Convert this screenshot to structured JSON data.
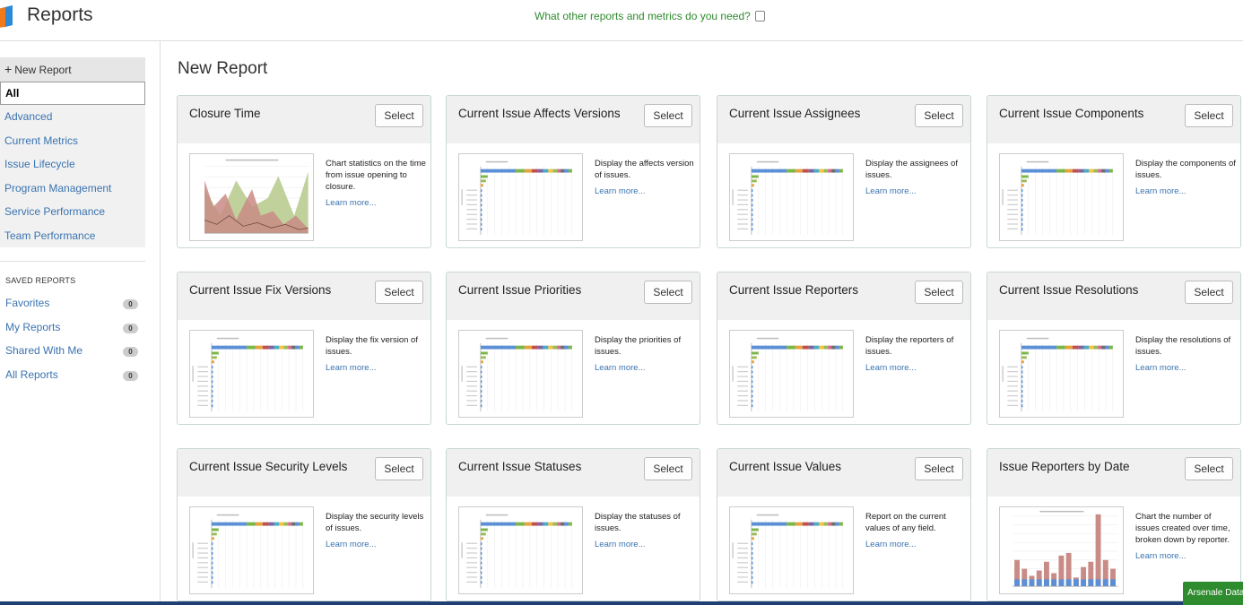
{
  "app": {
    "title": "Reports",
    "feedback_link": "What other reports and metrics do you need?"
  },
  "sidebar": {
    "new_report": "New Report",
    "categories": [
      "All",
      "Advanced",
      "Current Metrics",
      "Issue Lifecycle",
      "Program Management",
      "Service Performance",
      "Team Performance"
    ],
    "saved_heading": "SAVED REPORTS",
    "saved": [
      {
        "label": "Favorites",
        "count": "0"
      },
      {
        "label": "My Reports",
        "count": "0"
      },
      {
        "label": "Shared With Me",
        "count": "0"
      },
      {
        "label": "All Reports",
        "count": "0"
      }
    ]
  },
  "main": {
    "title": "New Report",
    "select_label": "Select",
    "learn_more": "Learn more...",
    "cards": [
      {
        "title": "Closure Time",
        "desc": "Chart statistics on the time from issue opening to closure.",
        "thumb": "area-chart"
      },
      {
        "title": "Current Issue Affects Versions",
        "desc": "Display the affects version of issues.",
        "thumb": "bar-chart"
      },
      {
        "title": "Current Issue Assignees",
        "desc": "Display the assignees of issues.",
        "thumb": "bar-chart"
      },
      {
        "title": "Current Issue Components",
        "desc": "Display the components of issues.",
        "thumb": "bar-chart"
      },
      {
        "title": "Current Issue Fix Versions",
        "desc": "Display the fix version of issues.",
        "thumb": "bar-chart"
      },
      {
        "title": "Current Issue Priorities",
        "desc": "Display the priorities of issues.",
        "thumb": "bar-chart"
      },
      {
        "title": "Current Issue Reporters",
        "desc": "Display the reporters of issues.",
        "thumb": "bar-chart"
      },
      {
        "title": "Current Issue Resolutions",
        "desc": "Display the resolutions of issues.",
        "thumb": "bar-chart"
      },
      {
        "title": "Current Issue Security Levels",
        "desc": "Display the security levels of issues.",
        "thumb": "bar-chart"
      },
      {
        "title": "Current Issue Statuses",
        "desc": "Display the statuses of issues.",
        "thumb": "bar-chart"
      },
      {
        "title": "Current Issue Values",
        "desc": "Report on the current values of any field.",
        "thumb": "bar-chart"
      },
      {
        "title": "Issue Reporters by Date",
        "desc": "Chart the number of issues created over time, broken down by reporter.",
        "thumb": "stacked-chart"
      }
    ]
  },
  "toast": {
    "label": "Arsenale Data"
  },
  "colors": {
    "link": "#3b73af",
    "feedback": "#2f8a2f",
    "header_bg": "#f0f0f0",
    "toast": "#2e8b2e"
  }
}
